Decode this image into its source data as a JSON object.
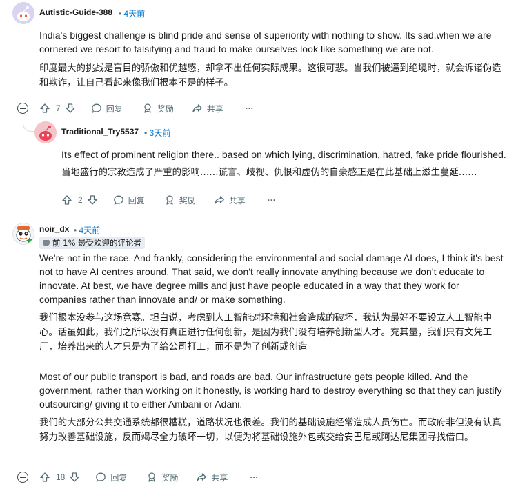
{
  "comments": [
    {
      "username": "Autistic-Guide-388",
      "time": "4天前",
      "body_en": "India's biggest challenge is blind pride and sense of superiority with nothing to show. Its sad.when we are cornered we resort to falsifying and fraud to make ourselves look like something we are not.",
      "body_zh": "印度最大的挑战是盲目的骄傲和优越感，却拿不出任何实际成果。这很可悲。当我们被逼到绝境时，就会诉诸伪造和欺诈，让自己看起来像我们根本不是的样子。",
      "votes": "7",
      "reply_label": "回复",
      "award_label": "奖励",
      "share_label": "共享",
      "more_label": "···"
    },
    {
      "username": "Traditional_Try5537",
      "time": "3天前",
      "body_en": "Its effect of prominent religion there.. based on which lying, discrimination, hatred, fake pride flourished..",
      "body_zh": "当地盛行的宗教造成了严重的影响……谎言、歧视、仇恨和虚伪的自豪感正是在此基础上滋生蔓延……",
      "votes": "2",
      "reply_label": "回复",
      "award_label": "奖励",
      "share_label": "共享",
      "more_label": "···"
    },
    {
      "username": "noir_dx",
      "time": "4天前",
      "flair": "前 1% 最受欢迎的评论者",
      "body_en_1": "We're not in the race. And frankly, considering the environmental and social damage AI does, I think it's best not to have AI centres around. That said, we don't really innovate anything because we don't educate to innovate. At best, we have degree mills and just have people educated in a way that they work for companies rather than innovate and/ or make something.",
      "body_zh_1": "我们根本没参与这场竞赛。坦白说，考虑到人工智能对环境和社会造成的破坏，我认为最好不要设立人工智能中心。话虽如此，我们之所以没有真正进行任何创新，是因为我们没有培养创新型人才。充其量，我们只有文凭工厂，培养出来的人才只是为了给公司打工，而不是为了创新或创造。",
      "body_en_2": "Most of our public transport is bad, and roads are bad. Our infrastructure gets people killed. And the government, rather than working on it honestly, is working hard to destroy everything so that they can justify outsourcing/ giving it to either Ambani or Adani.",
      "body_zh_2": "我们的大部分公共交通系统都很糟糕，道路状况也很差。我们的基础设施经常造成人员伤亡。而政府非但没有认真努力改善基础设施，反而竭尽全力破坏一切，以便为将基础设施外包或交给安巴尼或阿达尼集团寻找借口。",
      "votes": "18",
      "reply_label": "回复",
      "award_label": "奖励",
      "share_label": "共享",
      "more_label": "···"
    }
  ],
  "colors": {
    "meta": "#576f76",
    "link": "#0079d3",
    "thread_line": "#d6dbdf",
    "flair_bg": "#e6ecf1"
  }
}
